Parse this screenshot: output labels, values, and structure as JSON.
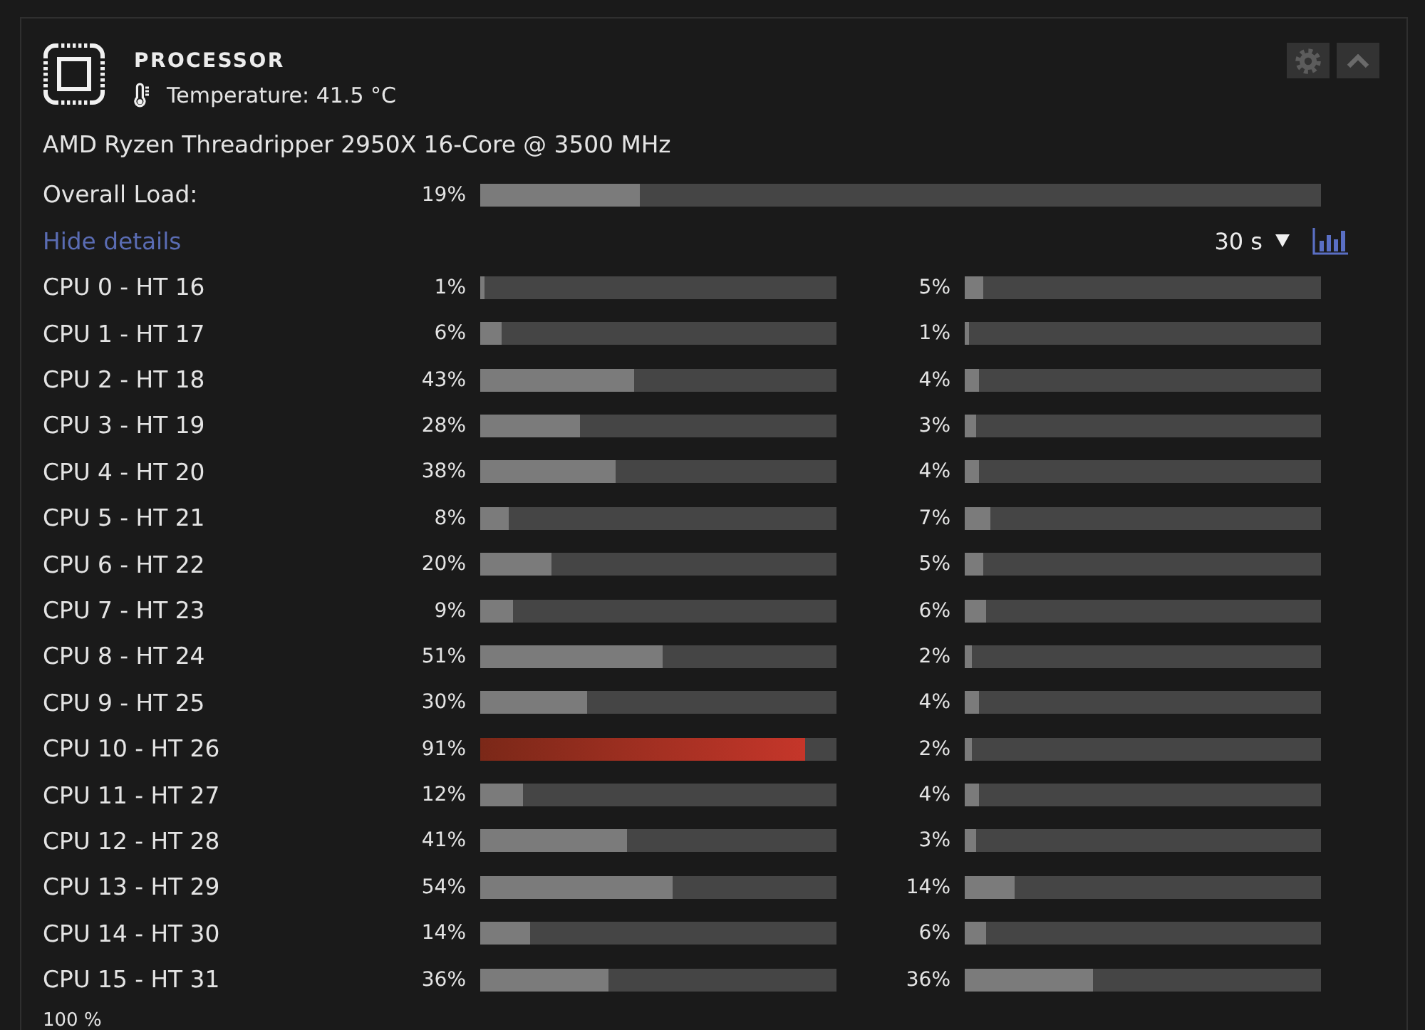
{
  "panel": {
    "title": "PROCESSOR",
    "temperature": "Temperature: 41.5 °C",
    "model": "AMD Ryzen Threadripper 2950X 16-Core @ 3500 MHz",
    "overall_load": {
      "label": "Overall Load:",
      "reading": "19%",
      "level": 0.19
    },
    "details_link": "Hide details",
    "interval": "30 s",
    "cores": [
      {
        "name": "CPU 0 - HT 16",
        "threads": [
          {
            "reading": "1%",
            "level": 0.01
          },
          {
            "reading": "5%",
            "level": 0.05
          }
        ]
      },
      {
        "name": "CPU 1 - HT 17",
        "threads": [
          {
            "reading": "6%",
            "level": 0.06
          },
          {
            "reading": "1%",
            "level": 0.01
          }
        ]
      },
      {
        "name": "CPU 2 - HT 18",
        "threads": [
          {
            "reading": "43%",
            "level": 0.43
          },
          {
            "reading": "4%",
            "level": 0.04
          }
        ]
      },
      {
        "name": "CPU 3 - HT 19",
        "threads": [
          {
            "reading": "28%",
            "level": 0.28
          },
          {
            "reading": "3%",
            "level": 0.03
          }
        ]
      },
      {
        "name": "CPU 4 - HT 20",
        "threads": [
          {
            "reading": "38%",
            "level": 0.38
          },
          {
            "reading": "4%",
            "level": 0.04
          }
        ]
      },
      {
        "name": "CPU 5 - HT 21",
        "threads": [
          {
            "reading": "8%",
            "level": 0.08
          },
          {
            "reading": "7%",
            "level": 0.07
          }
        ]
      },
      {
        "name": "CPU 6 - HT 22",
        "threads": [
          {
            "reading": "20%",
            "level": 0.2
          },
          {
            "reading": "5%",
            "level": 0.05
          }
        ]
      },
      {
        "name": "CPU 7 - HT 23",
        "threads": [
          {
            "reading": "9%",
            "level": 0.09
          },
          {
            "reading": "6%",
            "level": 0.06
          }
        ]
      },
      {
        "name": "CPU 8 - HT 24",
        "threads": [
          {
            "reading": "51%",
            "level": 0.51
          },
          {
            "reading": "2%",
            "level": 0.02
          }
        ]
      },
      {
        "name": "CPU 9 - HT 25",
        "threads": [
          {
            "reading": "30%",
            "level": 0.3
          },
          {
            "reading": "4%",
            "level": 0.04
          }
        ]
      },
      {
        "name": "CPU 10 - HT 26",
        "threads": [
          {
            "reading": "91%",
            "level": 0.91
          },
          {
            "reading": "2%",
            "level": 0.02
          }
        ]
      },
      {
        "name": "CPU 11 - HT 27",
        "threads": [
          {
            "reading": "12%",
            "level": 0.12
          },
          {
            "reading": "4%",
            "level": 0.04
          }
        ]
      },
      {
        "name": "CPU 12 - HT 28",
        "threads": [
          {
            "reading": "41%",
            "level": 0.41
          },
          {
            "reading": "3%",
            "level": 0.03
          }
        ]
      },
      {
        "name": "CPU 13 - HT 29",
        "threads": [
          {
            "reading": "54%",
            "level": 0.54
          },
          {
            "reading": "14%",
            "level": 0.14
          }
        ]
      },
      {
        "name": "CPU 14 - HT 30",
        "threads": [
          {
            "reading": "14%",
            "level": 0.14
          },
          {
            "reading": "6%",
            "level": 0.06
          }
        ]
      },
      {
        "name": "CPU 15 - HT 31",
        "threads": [
          {
            "reading": "36%",
            "level": 0.36
          },
          {
            "reading": "36%",
            "level": 0.36
          }
        ]
      }
    ],
    "axis_label": "100 %"
  }
}
